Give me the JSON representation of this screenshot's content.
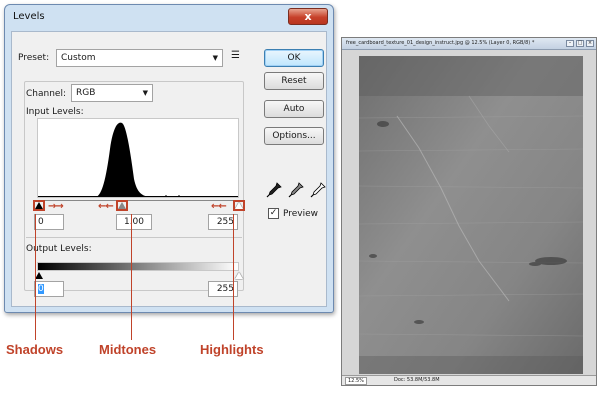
{
  "dialog": {
    "title": "Levels",
    "close_label": "x",
    "preset_label": "Preset:",
    "preset_value": "Custom",
    "channel_label": "Channel:",
    "channel_value": "RGB",
    "input_levels_label": "Input Levels:",
    "output_levels_label": "Output Levels:",
    "input_values": {
      "shadows": "0",
      "midtones": "1.00",
      "highlights": "255"
    },
    "output_values": {
      "black": "0",
      "white": "255"
    },
    "buttons": {
      "ok": "OK",
      "reset": "Reset",
      "auto": "Auto",
      "options": "Options..."
    },
    "preview_label": "Preview",
    "preview_checked": true,
    "eyedroppers": [
      "black-eyedropper-icon",
      "gray-eyedropper-icon",
      "white-eyedropper-icon"
    ]
  },
  "callouts": {
    "shadows": "Shadows",
    "midtones": "Midtones",
    "highlights": "Highlights"
  },
  "accent_color": "#c0432a",
  "document": {
    "title": "free_cardboard_texture_01_design_instruct.jpg @ 12.5% (Layer 0, RGB/8) *",
    "zoom": "12.5%",
    "doc_info": "Doc: 53.8M/53.8M"
  }
}
